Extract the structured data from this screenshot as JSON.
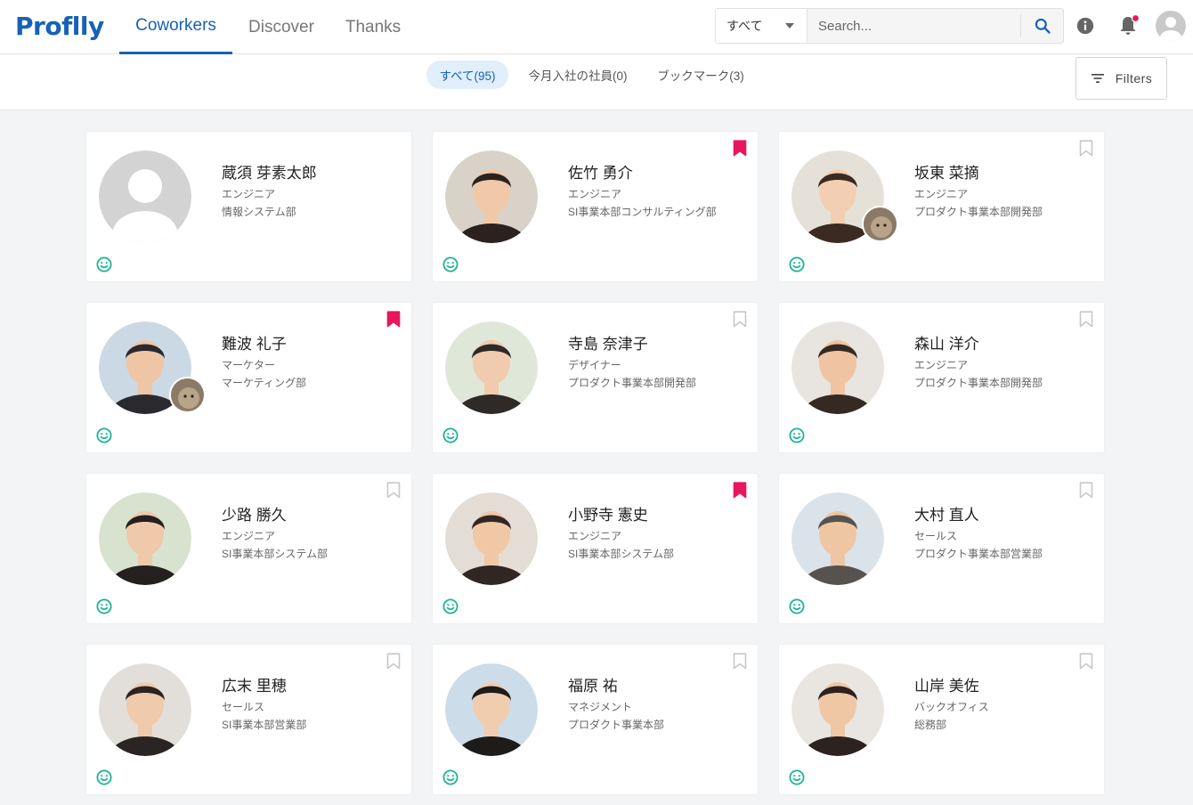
{
  "app": {
    "logo_text": "Proflly",
    "nav": [
      "Coworkers",
      "Discover",
      "Thanks"
    ]
  },
  "search": {
    "scope": "すべて",
    "placeholder": "Search..."
  },
  "icons": {
    "search": "search-icon",
    "info": "info-icon",
    "notification": "bell-icon",
    "account": "account-icon"
  },
  "filters": {
    "chips": [
      "すべて(95)",
      "今月入社の社員(0)",
      "ブックマーク(3)"
    ],
    "button_label": "Filters"
  },
  "colors": {
    "brand": "#1761b8",
    "bookmark_active": "#e8175d",
    "bookmark_inactive": "#c8c8c8",
    "smile": "#1bb394"
  },
  "people": [
    {
      "name": "蔵須 芽素太郎",
      "role": "エンジニア",
      "dept": "情報システム部",
      "bookmarked": null,
      "photo": false,
      "pet": false
    },
    {
      "name": "佐竹 勇介",
      "role": "エンジニア",
      "dept": "SI事業本部コンサルティング部",
      "bookmarked": true,
      "photo": true,
      "pet": false
    },
    {
      "name": "坂東 菜摘",
      "role": "エンジニア",
      "dept": "プロダクト事業本部開発部",
      "bookmarked": false,
      "photo": true,
      "pet": true
    },
    {
      "name": "難波 礼子",
      "role": "マーケター",
      "dept": "マーケティング部",
      "bookmarked": true,
      "photo": true,
      "pet": true
    },
    {
      "name": "寺島 奈津子",
      "role": "デザイナー",
      "dept": "プロダクト事業本部開発部",
      "bookmarked": false,
      "photo": true,
      "pet": false
    },
    {
      "name": "森山 洋介",
      "role": "エンジニア",
      "dept": "プロダクト事業本部開発部",
      "bookmarked": false,
      "photo": true,
      "pet": false
    },
    {
      "name": "少路 勝久",
      "role": "エンジニア",
      "dept": "SI事業本部システム部",
      "bookmarked": false,
      "photo": true,
      "pet": false
    },
    {
      "name": "小野寺 憲史",
      "role": "エンジニア",
      "dept": "SI事業本部システム部",
      "bookmarked": true,
      "photo": true,
      "pet": false
    },
    {
      "name": "大村 直人",
      "role": "セールス",
      "dept": "プロダクト事業本部営業部",
      "bookmarked": false,
      "photo": true,
      "pet": false
    },
    {
      "name": "広末 里穂",
      "role": "セールス",
      "dept": "SI事業本部営業部",
      "bookmarked": false,
      "photo": true,
      "pet": false
    },
    {
      "name": "福原 祐",
      "role": "マネジメント",
      "dept": "プロダクト事業本部",
      "bookmarked": false,
      "photo": true,
      "pet": false
    },
    {
      "name": "山岸 美佐",
      "role": "バックオフィス",
      "dept": "総務部",
      "bookmarked": false,
      "photo": true,
      "pet": false
    }
  ]
}
